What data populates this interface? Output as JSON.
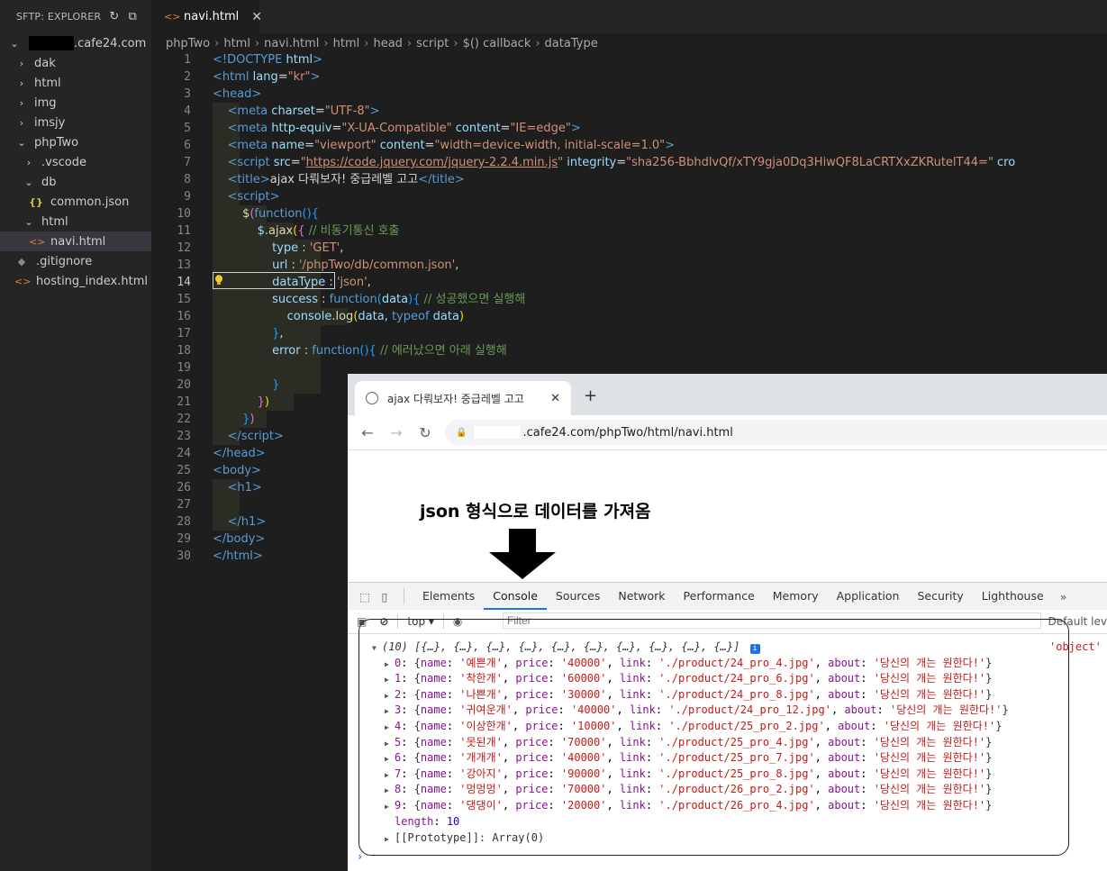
{
  "explorer": {
    "title": "SFTP: EXPLORER",
    "root_suffix": ".cafe24.com",
    "items": [
      {
        "label": "dak",
        "kind": "folder",
        "open": false,
        "depth": 1
      },
      {
        "label": "html",
        "kind": "folder",
        "open": false,
        "depth": 1
      },
      {
        "label": "img",
        "kind": "folder",
        "open": false,
        "depth": 1
      },
      {
        "label": "imsjy",
        "kind": "folder",
        "open": false,
        "depth": 1
      },
      {
        "label": "phpTwo",
        "kind": "folder",
        "open": true,
        "depth": 1
      },
      {
        "label": ".vscode",
        "kind": "folder",
        "open": false,
        "depth": 2
      },
      {
        "label": "db",
        "kind": "folder",
        "open": true,
        "depth": 2
      },
      {
        "label": "common.json",
        "kind": "json",
        "depth": 3
      },
      {
        "label": "html",
        "kind": "folder",
        "open": true,
        "depth": 2
      },
      {
        "label": "navi.html",
        "kind": "html",
        "depth": 3,
        "selected": true
      },
      {
        "label": ".gitignore",
        "kind": "git",
        "depth": 1
      },
      {
        "label": "hosting_index.html",
        "kind": "html",
        "depth": 1
      }
    ]
  },
  "editor_tab": {
    "label": "navi.html",
    "close": "✕"
  },
  "breadcrumb": [
    "phpTwo",
    "html",
    "navi.html",
    "html",
    "head",
    "script",
    "$() callback",
    "dataType"
  ],
  "editor": {
    "current_line": 14,
    "line_numbers": [
      "1",
      "2",
      "3",
      "4",
      "5",
      "6",
      "7",
      "8",
      "9",
      "10",
      "11",
      "12",
      "13",
      "14",
      "15",
      "16",
      "17",
      "18",
      "19",
      "20",
      "21",
      "22",
      "23",
      "24",
      "25",
      "26",
      "27",
      "28",
      "29",
      "30"
    ]
  },
  "browser": {
    "tab_title": "ajax 다뤄보자! 중급레벨 고고",
    "tab_close": "✕",
    "new_tab": "+",
    "url_suffix": ".cafe24.com/phpTwo/html/navi.html",
    "heading": "json 형식으로 데이터를 가져옴"
  },
  "devtools": {
    "tabs": [
      "Elements",
      "Console",
      "Sources",
      "Network",
      "Performance",
      "Memory",
      "Application",
      "Security",
      "Lighthouse"
    ],
    "active_tab": "Console",
    "more": "»",
    "context": "top",
    "filter_placeholder": "Filter",
    "levels": "Default lev",
    "array_summary": "(10) [{…}, {…}, {…}, {…}, {…}, {…}, {…}, {…}, {…}, {…}]",
    "typeof_output": "'object'",
    "rows": [
      {
        "idx": "0",
        "name": "'예쁜개'",
        "price": "'40000'",
        "link": "'./product/24_pro_4.jpg'",
        "about": "'당신의 개는 원한다!'"
      },
      {
        "idx": "1",
        "name": "'착한개'",
        "price": "'60000'",
        "link": "'./product/24_pro_6.jpg'",
        "about": "'당신의 개는 원한다!'"
      },
      {
        "idx": "2",
        "name": "'나쁜개'",
        "price": "'30000'",
        "link": "'./product/24_pro_8.jpg'",
        "about": "'당신의 개는 원한다!'"
      },
      {
        "idx": "3",
        "name": "'귀여운개'",
        "price": "'40000'",
        "link": "'./product/24_pro_12.jpg'",
        "about": "'당신의 개는 원한다!'"
      },
      {
        "idx": "4",
        "name": "'이상한개'",
        "price": "'10000'",
        "link": "'./product/25_pro_2.jpg'",
        "about": "'당신의 개는 원한다!'"
      },
      {
        "idx": "5",
        "name": "'못된개'",
        "price": "'70000'",
        "link": "'./product/25_pro_4.jpg'",
        "about": "'당신의 개는 원한다!'"
      },
      {
        "idx": "6",
        "name": "'개개개'",
        "price": "'40000'",
        "link": "'./product/25_pro_7.jpg'",
        "about": "'당신의 개는 원한다!'"
      },
      {
        "idx": "7",
        "name": "'강아지'",
        "price": "'90000'",
        "link": "'./product/25_pro_8.jpg'",
        "about": "'당신의 개는 원한다!'"
      },
      {
        "idx": "8",
        "name": "'멍멍멍'",
        "price": "'70000'",
        "link": "'./product/26_pro_2.jpg'",
        "about": "'당신의 개는 원한다!'"
      },
      {
        "idx": "9",
        "name": "'댕댕이'",
        "price": "'20000'",
        "link": "'./product/26_pro_4.jpg'",
        "about": "'당신의 개는 원한다!'"
      }
    ],
    "length_key": "length",
    "length_value": "10",
    "prototype": "[[Prototype]]: Array(0)",
    "prompt": "›"
  }
}
